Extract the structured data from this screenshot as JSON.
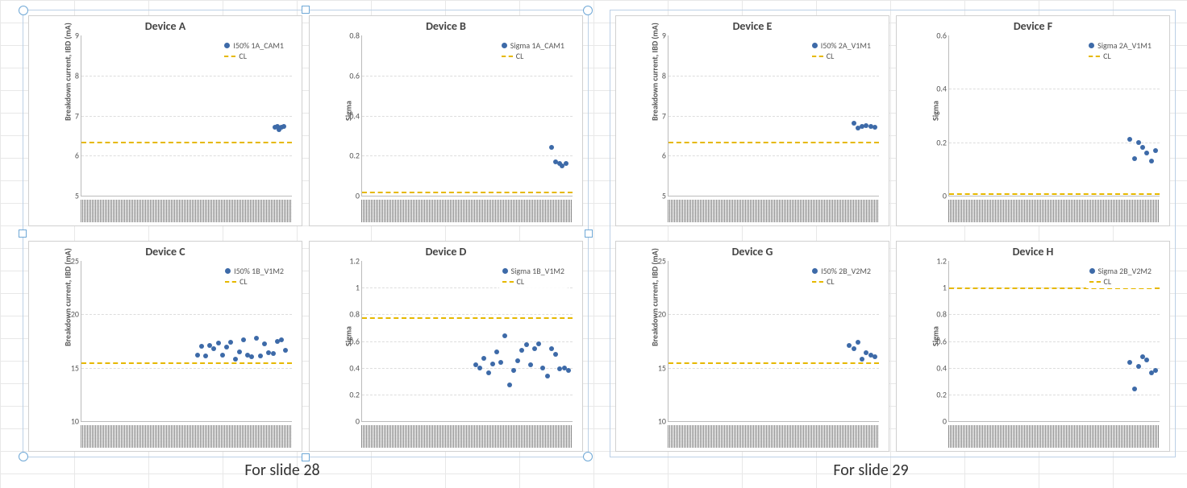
{
  "captions": {
    "slide28": "For slide 28",
    "slide29": "For slide 29"
  },
  "legend_cl": "CL",
  "chart_data": [
    {
      "id": "A",
      "type": "scatter",
      "title": "Device A",
      "ylabel": "Breakdown current, IBD (mA)",
      "ylim": [
        5,
        9
      ],
      "yticks": [
        5,
        6,
        7,
        8,
        9
      ],
      "cl": 6.35,
      "series_name": "I50% 1A_CAM1",
      "points": [
        {
          "x": 0.92,
          "y": 6.7
        },
        {
          "x": 0.93,
          "y": 6.72
        },
        {
          "x": 0.94,
          "y": 6.65
        },
        {
          "x": 0.95,
          "y": 6.7
        },
        {
          "x": 0.96,
          "y": 6.73
        }
      ]
    },
    {
      "id": "B",
      "type": "scatter",
      "title": "Device B",
      "ylabel": "Sigma",
      "ylim": [
        0,
        0.8
      ],
      "yticks": [
        0,
        0.2,
        0.4,
        0.6,
        0.8
      ],
      "cl": 0.02,
      "series_name": "Sigma 1A_CAM1",
      "points": [
        {
          "x": 0.9,
          "y": 0.24
        },
        {
          "x": 0.92,
          "y": 0.17
        },
        {
          "x": 0.94,
          "y": 0.16
        },
        {
          "x": 0.95,
          "y": 0.15
        },
        {
          "x": 0.97,
          "y": 0.16
        }
      ]
    },
    {
      "id": "C",
      "type": "scatter",
      "title": "Device C",
      "ylabel": "Breakdown current, IBD (mA)",
      "ylim": [
        10,
        25
      ],
      "yticks": [
        10,
        15,
        20,
        25
      ],
      "cl": 15.5,
      "series_name": "I50% 1B_V1M2",
      "points": [
        {
          "x": 0.55,
          "y": 16.2
        },
        {
          "x": 0.57,
          "y": 17.0
        },
        {
          "x": 0.59,
          "y": 16.1
        },
        {
          "x": 0.61,
          "y": 17.1
        },
        {
          "x": 0.63,
          "y": 16.8
        },
        {
          "x": 0.65,
          "y": 17.3
        },
        {
          "x": 0.67,
          "y": 16.2
        },
        {
          "x": 0.69,
          "y": 16.9
        },
        {
          "x": 0.71,
          "y": 17.4
        },
        {
          "x": 0.73,
          "y": 15.8
        },
        {
          "x": 0.75,
          "y": 16.5
        },
        {
          "x": 0.77,
          "y": 17.6
        },
        {
          "x": 0.79,
          "y": 16.2
        },
        {
          "x": 0.81,
          "y": 16.0
        },
        {
          "x": 0.83,
          "y": 17.8
        },
        {
          "x": 0.85,
          "y": 16.1
        },
        {
          "x": 0.87,
          "y": 17.2
        },
        {
          "x": 0.89,
          "y": 16.4
        },
        {
          "x": 0.91,
          "y": 16.3
        },
        {
          "x": 0.93,
          "y": 17.5
        },
        {
          "x": 0.95,
          "y": 17.6
        },
        {
          "x": 0.97,
          "y": 16.6
        }
      ]
    },
    {
      "id": "D",
      "type": "scatter",
      "title": "Device D",
      "ylabel": "Sigma",
      "ylim": [
        0,
        1.2
      ],
      "yticks": [
        0,
        0.2,
        0.4,
        0.6,
        0.8,
        1,
        1.2
      ],
      "cl": 0.78,
      "series_name": "Sigma 1B_V1M2",
      "points": [
        {
          "x": 0.54,
          "y": 0.42
        },
        {
          "x": 0.56,
          "y": 0.4
        },
        {
          "x": 0.58,
          "y": 0.47
        },
        {
          "x": 0.6,
          "y": 0.36
        },
        {
          "x": 0.62,
          "y": 0.43
        },
        {
          "x": 0.64,
          "y": 0.52
        },
        {
          "x": 0.66,
          "y": 0.44
        },
        {
          "x": 0.68,
          "y": 0.64
        },
        {
          "x": 0.7,
          "y": 0.27
        },
        {
          "x": 0.72,
          "y": 0.38
        },
        {
          "x": 0.74,
          "y": 0.45
        },
        {
          "x": 0.76,
          "y": 0.53
        },
        {
          "x": 0.78,
          "y": 0.57
        },
        {
          "x": 0.8,
          "y": 0.42
        },
        {
          "x": 0.82,
          "y": 0.54
        },
        {
          "x": 0.84,
          "y": 0.58
        },
        {
          "x": 0.86,
          "y": 0.4
        },
        {
          "x": 0.88,
          "y": 0.34
        },
        {
          "x": 0.9,
          "y": 0.54
        },
        {
          "x": 0.92,
          "y": 0.5
        },
        {
          "x": 0.94,
          "y": 0.39
        },
        {
          "x": 0.96,
          "y": 0.4
        },
        {
          "x": 0.98,
          "y": 0.38
        }
      ]
    },
    {
      "id": "E",
      "type": "scatter",
      "title": "Device E",
      "ylabel": "Breakdown current, IBD (mA)",
      "ylim": [
        5,
        9
      ],
      "yticks": [
        5,
        6,
        7,
        8,
        9
      ],
      "cl": 6.35,
      "series_name": "I50% 2A_V1M1",
      "points": [
        {
          "x": 0.88,
          "y": 6.8
        },
        {
          "x": 0.9,
          "y": 6.68
        },
        {
          "x": 0.92,
          "y": 6.72
        },
        {
          "x": 0.94,
          "y": 6.74
        },
        {
          "x": 0.96,
          "y": 6.73
        },
        {
          "x": 0.98,
          "y": 6.71
        }
      ]
    },
    {
      "id": "F",
      "type": "scatter",
      "title": "Device F",
      "ylabel": "Sigma",
      "ylim": [
        0,
        0.6
      ],
      "yticks": [
        0,
        0.2,
        0.4,
        0.6
      ],
      "cl": 0.01,
      "series_name": "Sigma 2A_V1M1",
      "points": [
        {
          "x": 0.86,
          "y": 0.21
        },
        {
          "x": 0.88,
          "y": 0.14
        },
        {
          "x": 0.9,
          "y": 0.2
        },
        {
          "x": 0.92,
          "y": 0.18
        },
        {
          "x": 0.94,
          "y": 0.16
        },
        {
          "x": 0.96,
          "y": 0.13
        },
        {
          "x": 0.98,
          "y": 0.17
        }
      ]
    },
    {
      "id": "G",
      "type": "scatter",
      "title": "Device G",
      "ylabel": "Breakdown current, IBD (mA)",
      "ylim": [
        10,
        25
      ],
      "yticks": [
        10,
        15,
        20,
        25
      ],
      "cl": 15.5,
      "series_name": "I50% 2B_V2M2",
      "points": [
        {
          "x": 0.86,
          "y": 17.1
        },
        {
          "x": 0.88,
          "y": 16.8
        },
        {
          "x": 0.9,
          "y": 17.4
        },
        {
          "x": 0.92,
          "y": 15.8
        },
        {
          "x": 0.94,
          "y": 16.4
        },
        {
          "x": 0.96,
          "y": 16.2
        },
        {
          "x": 0.98,
          "y": 16.0
        }
      ]
    },
    {
      "id": "H",
      "type": "scatter",
      "title": "Device H",
      "ylabel": "Sigma",
      "ylim": [
        0,
        1.2
      ],
      "yticks": [
        0,
        0.2,
        0.4,
        0.6,
        0.8,
        1,
        1.2
      ],
      "cl": 1.0,
      "series_name": "Sigma 2B_V2M2",
      "points": [
        {
          "x": 0.86,
          "y": 0.44
        },
        {
          "x": 0.88,
          "y": 0.24
        },
        {
          "x": 0.9,
          "y": 0.41
        },
        {
          "x": 0.92,
          "y": 0.48
        },
        {
          "x": 0.94,
          "y": 0.46
        },
        {
          "x": 0.96,
          "y": 0.36
        },
        {
          "x": 0.98,
          "y": 0.38
        }
      ]
    }
  ]
}
